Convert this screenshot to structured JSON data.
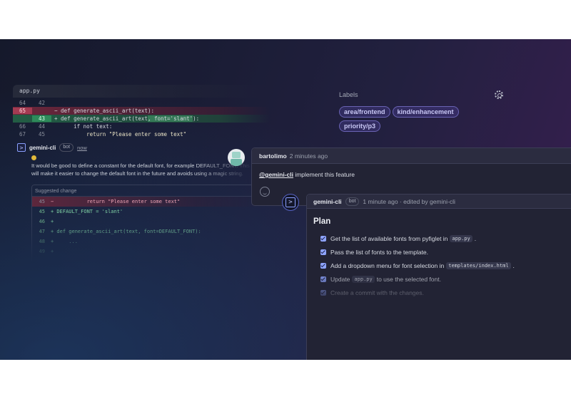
{
  "diff": {
    "filename": "app.py",
    "lines": [
      {
        "old": "64",
        "new": "42",
        "type": "ctx",
        "code": ""
      },
      {
        "old": "65",
        "new": "",
        "type": "del",
        "marker": "−",
        "code_pre": " def generate_ascii_art(text):",
        "highlight": ""
      },
      {
        "old": "",
        "new": "43",
        "type": "add",
        "marker": "+",
        "code_pre": " def generate_ascii_art(text",
        "highlight": ", font='slant'",
        "code_post": "):"
      },
      {
        "old": "66",
        "new": "44",
        "type": "ctx",
        "code": "      if not text:"
      },
      {
        "old": "67",
        "new": "45",
        "type": "ctx",
        "code": "          return \"Please enter some text\""
      }
    ]
  },
  "bot_comment": {
    "author": "gemini-cli",
    "badge": "bot",
    "time": "now",
    "text": "It would be good to define a constant for the default font, for example DEFAULT_FONT. This will make it easier to change the default font in the future and avoids using a magic string.",
    "suggested_title": "Suggested change",
    "suggested_lines": [
      {
        "n": "45",
        "type": "del",
        "code": "−           return \"Please enter some text\""
      },
      {
        "n": "45",
        "type": "add",
        "code": "+ DEFAULT_FONT = 'slant'"
      },
      {
        "n": "46",
        "type": "add",
        "code": "+"
      },
      {
        "n": "47",
        "type": "add",
        "code": "+ def generate_ascii_art(text, font=DEFAULT_FONT):"
      },
      {
        "n": "48",
        "type": "add",
        "code": "+     ..."
      },
      {
        "n": "49",
        "type": "add",
        "code": "+"
      }
    ]
  },
  "labels": {
    "title": "Labels",
    "items": [
      "area/frontend",
      "kind/enhancement",
      "priority/p3"
    ]
  },
  "comment1": {
    "author": "bartolimo",
    "time": "2 minutes ago",
    "mention": "@gemini-cli",
    "text": " implement this feature"
  },
  "comment2": {
    "author": "gemini-cli",
    "badge": "bot",
    "meta": "1 minute ago · edited by gemini-cli",
    "plan_title": "Plan",
    "tasks": [
      {
        "pre": "Get the list of available fonts from pyfiglet in",
        "code": "app.py",
        "post": "."
      },
      {
        "pre": "Pass the list of fonts to the template.",
        "code": "",
        "post": ""
      },
      {
        "pre": "Add a dropdown menu for font selection in",
        "code": "templates/index.html",
        "post": "."
      },
      {
        "pre": "Update",
        "code": "app.py",
        "post": "to use the selected font."
      },
      {
        "pre": "Create a commit with the changes.",
        "code": "",
        "post": ""
      }
    ]
  },
  "colors": {
    "accent": "#8ea4ff",
    "label_chip": "#6a63b4",
    "diff_del": "#a33b52",
    "diff_add": "#2e8a5a"
  }
}
